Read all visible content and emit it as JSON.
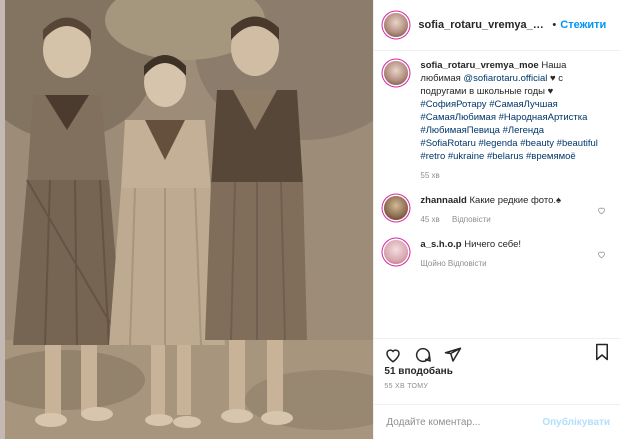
{
  "post": {
    "photo_alt": "",
    "header": {
      "username": "sofia_rotaru_vremya_moe",
      "separator": "•",
      "follow_label": "Стежити"
    },
    "caption": {
      "username": "sofia_rotaru_vremya_moe",
      "text_before": "Наша любимая ",
      "mention": "@sofiarotaru.official",
      "text_after": " ♥ с подругами в школьные годы ♥",
      "hashtags": "#СофияРотару #СамаяЛучшая #СамаяЛюбимая #НароднаяАртистка #ЛюбимаяПевица #Легенда #SofiaRotaru #legenda #beauty #beautiful #retro #ukraine #belarus #времямоё",
      "time": "55 хв"
    },
    "comments": [
      {
        "username": "zhannaald",
        "text": "Какие редкие фото.♠",
        "time": "45 хв",
        "reply_label": "Відповісти"
      },
      {
        "username": "a_s.h.o.p",
        "text": "Ничего себе!",
        "time": "",
        "reply_label": "Щойно  Відповісти"
      }
    ],
    "likes": "51 вподобань",
    "ago": "55 ХВ ТОМУ",
    "add_comment_placeholder": "Додайте коментар...",
    "publish_label": "Опублікувати"
  },
  "icons": [
    "heart-icon",
    "comment-icon",
    "share-icon",
    "bookmark-icon",
    "like-comment-icon"
  ]
}
